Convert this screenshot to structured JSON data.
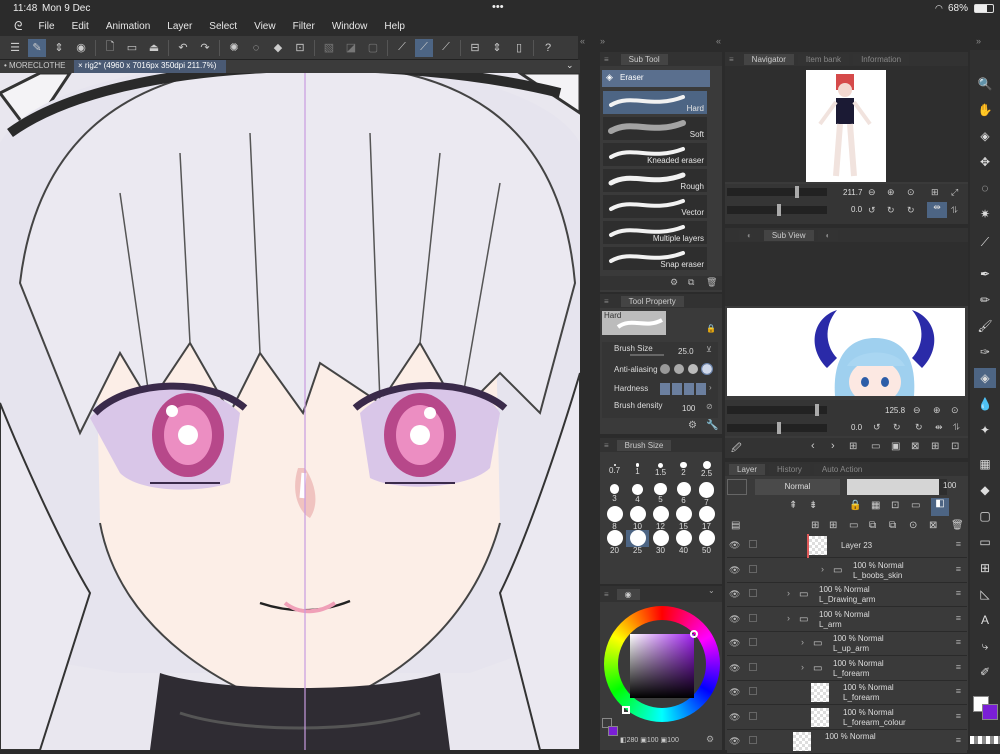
{
  "status": {
    "time": "11:48",
    "date": "Mon 9 Dec",
    "dots": "•••",
    "battery": "68%"
  },
  "menu": [
    "File",
    "Edit",
    "Animation",
    "Layer",
    "Select",
    "View",
    "Filter",
    "Window",
    "Help"
  ],
  "doc_tabs": [
    "MORECLOTHE",
    "rig2* (4960 x 7016px 350dpi 211.7%)"
  ],
  "subtool": {
    "tab": "Sub Tool",
    "group": "Eraser",
    "brushes": [
      "Hard",
      "Soft",
      "Kneaded eraser",
      "Rough",
      "Vector",
      "Multiple layers",
      "Snap eraser"
    ]
  },
  "tool_property": {
    "tab": "Tool Property",
    "preset": "Hard",
    "brush_size_label": "Brush Size",
    "brush_size_value": "25.0",
    "anti_aliasing_label": "Anti-aliasing",
    "hardness_label": "Hardness",
    "brush_density_label": "Brush density",
    "brush_density_value": "100"
  },
  "brush_size_panel": {
    "tab": "Brush Size",
    "sizes": [
      "0.7",
      "1",
      "1.5",
      "2",
      "2.5",
      "3",
      "4",
      "5",
      "6",
      "7",
      "8",
      "10",
      "12",
      "15",
      "17",
      "20",
      "25",
      "30",
      "40",
      "50"
    ],
    "selected": "25"
  },
  "color": {
    "main": "#ffffff",
    "sub": "#7a1fd6",
    "hsv_readout": "280",
    "s_readout": "100",
    "v_readout": "100"
  },
  "navigator": {
    "tabs": [
      "Navigator",
      "Item bank",
      "Information"
    ],
    "zoom": "211.7",
    "rotation": "0.0"
  },
  "subview": {
    "tab": "Sub View",
    "zoom": "125.8",
    "rotation": "0.0"
  },
  "layer_panel": {
    "tabs": [
      "Layer",
      "History",
      "Auto Action"
    ],
    "blend_mode": "Normal",
    "opacity": "100",
    "layers": [
      {
        "name": "Layer 23",
        "info": "",
        "type": "raster"
      },
      {
        "name": "L_boobs_skin",
        "info": "100 % Normal",
        "type": "folder"
      },
      {
        "name": "L_Drawing_arm",
        "info": "100 % Normal",
        "type": "folder"
      },
      {
        "name": "L_arm",
        "info": "100 % Normal",
        "type": "folder"
      },
      {
        "name": "L_up_arm",
        "info": "100 % Normal",
        "type": "folder"
      },
      {
        "name": "L_forearm",
        "info": "100 % Normal",
        "type": "folder"
      },
      {
        "name": "L_forearm",
        "info": "100 % Normal",
        "type": "raster"
      },
      {
        "name": "L_forearm_colour",
        "info": "100 % Normal",
        "type": "raster"
      },
      {
        "name": "",
        "info": "100 % Normal",
        "type": "raster"
      }
    ]
  }
}
